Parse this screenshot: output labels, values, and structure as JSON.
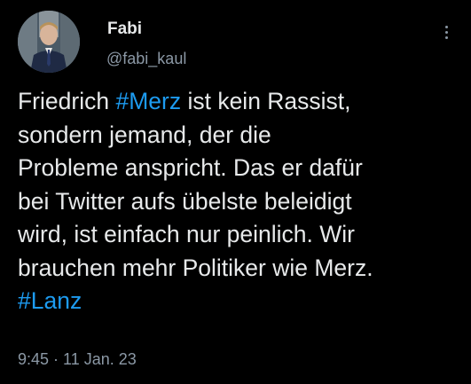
{
  "colors": {
    "background": "#000000",
    "text": "#e7e9ea",
    "secondary": "#8b98a5",
    "accent": "#1d9bf0"
  },
  "user": {
    "display_name": "Fabi",
    "handle": "@fabi_kaul",
    "avatar_icon": "profile-photo"
  },
  "menu": {
    "icon": "more-vertical-icon"
  },
  "tweet": {
    "line1_pre": "Friedrich ",
    "hashtag1": "#Merz",
    "line1_post": " ist kein Rassist,",
    "line2": "sondern jemand, der die",
    "line3": "Probleme anspricht. Das er dafür",
    "line4": "bei Twitter aufs übelste beleidigt",
    "line5": "wird, ist einfach nur peinlich. Wir",
    "line6": "brauchen mehr Politiker wie Merz.",
    "hashtag2": "#Lanz"
  },
  "meta": {
    "timestamp": "9:45 · 11 Jan. 23"
  }
}
